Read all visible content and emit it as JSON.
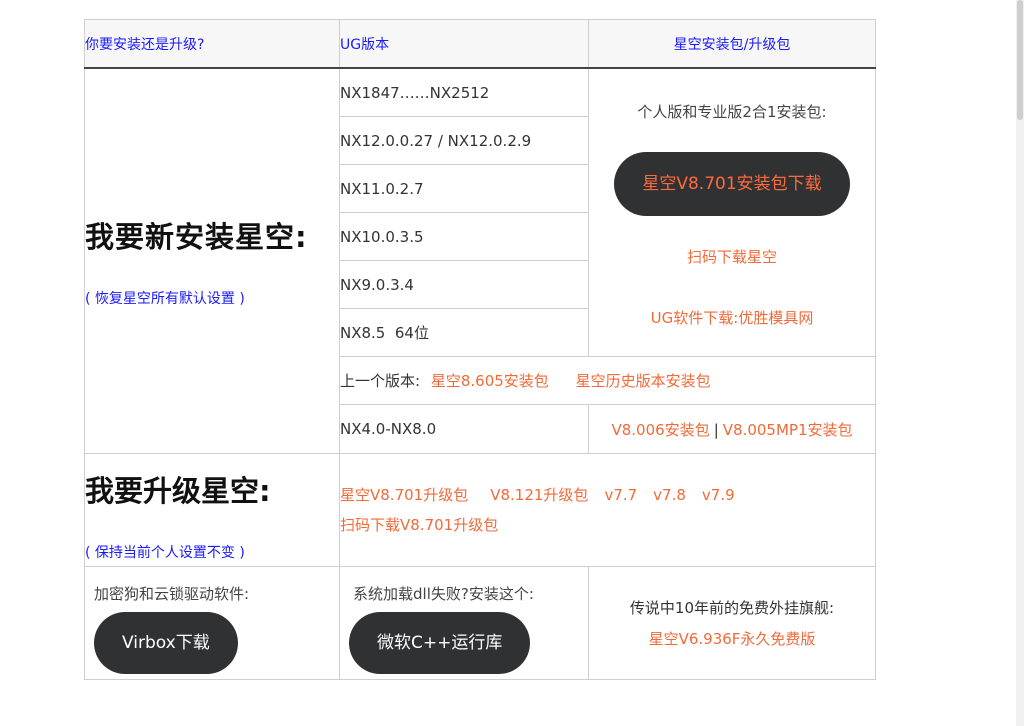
{
  "header": {
    "col1": "你要安装还是升级?",
    "col2": "UG版本",
    "col3": "星空安装包/升级包"
  },
  "install": {
    "title": "我要新安装星空:",
    "note": "( 恢复星空所有默认设置 )",
    "versions": [
      "NX1847……NX2512",
      "NX12.0.0.27 / NX12.0.2.9",
      "NX11.0.2.7",
      "NX10.0.3.5",
      "NX9.0.3.4",
      "NX8.5  64位"
    ],
    "package_label": "个人版和专业版2合1安装包:",
    "download_button": "星空V8.701安装包下载",
    "qr_link": "扫码下载星空",
    "ug_link": "UG软件下载:优胜模具网",
    "previous_label": "上一个版本:",
    "previous_pkg": "星空8.605安装包",
    "history_pkg": "星空历史版本安装包",
    "old_version": "NX4.0-NX8.0",
    "old_pkg1": "V8.006安装包",
    "old_sep": "|",
    "old_pkg2": "V8.005MP1安装包"
  },
  "upgrade": {
    "title": "我要升级星空:",
    "note": "( 保持当前个人设置不变 )",
    "links": [
      "星空V8.701升级包",
      "V8.121升级包",
      "v7.7",
      "v7.8",
      "v7.9"
    ],
    "qr_link": "扫码下载V8.701升级包"
  },
  "bottom": {
    "dongle_label": "加密狗和云锁驱动软件:",
    "virbox_button": "Virbox下载",
    "dll_label": "系统加载dll失败?安装这个:",
    "vcpp_button": "微软C++运行库",
    "legend_label": "传说中10年前的免费外挂旗舰:",
    "legend_link": "星空V6.936F永久免费版"
  }
}
